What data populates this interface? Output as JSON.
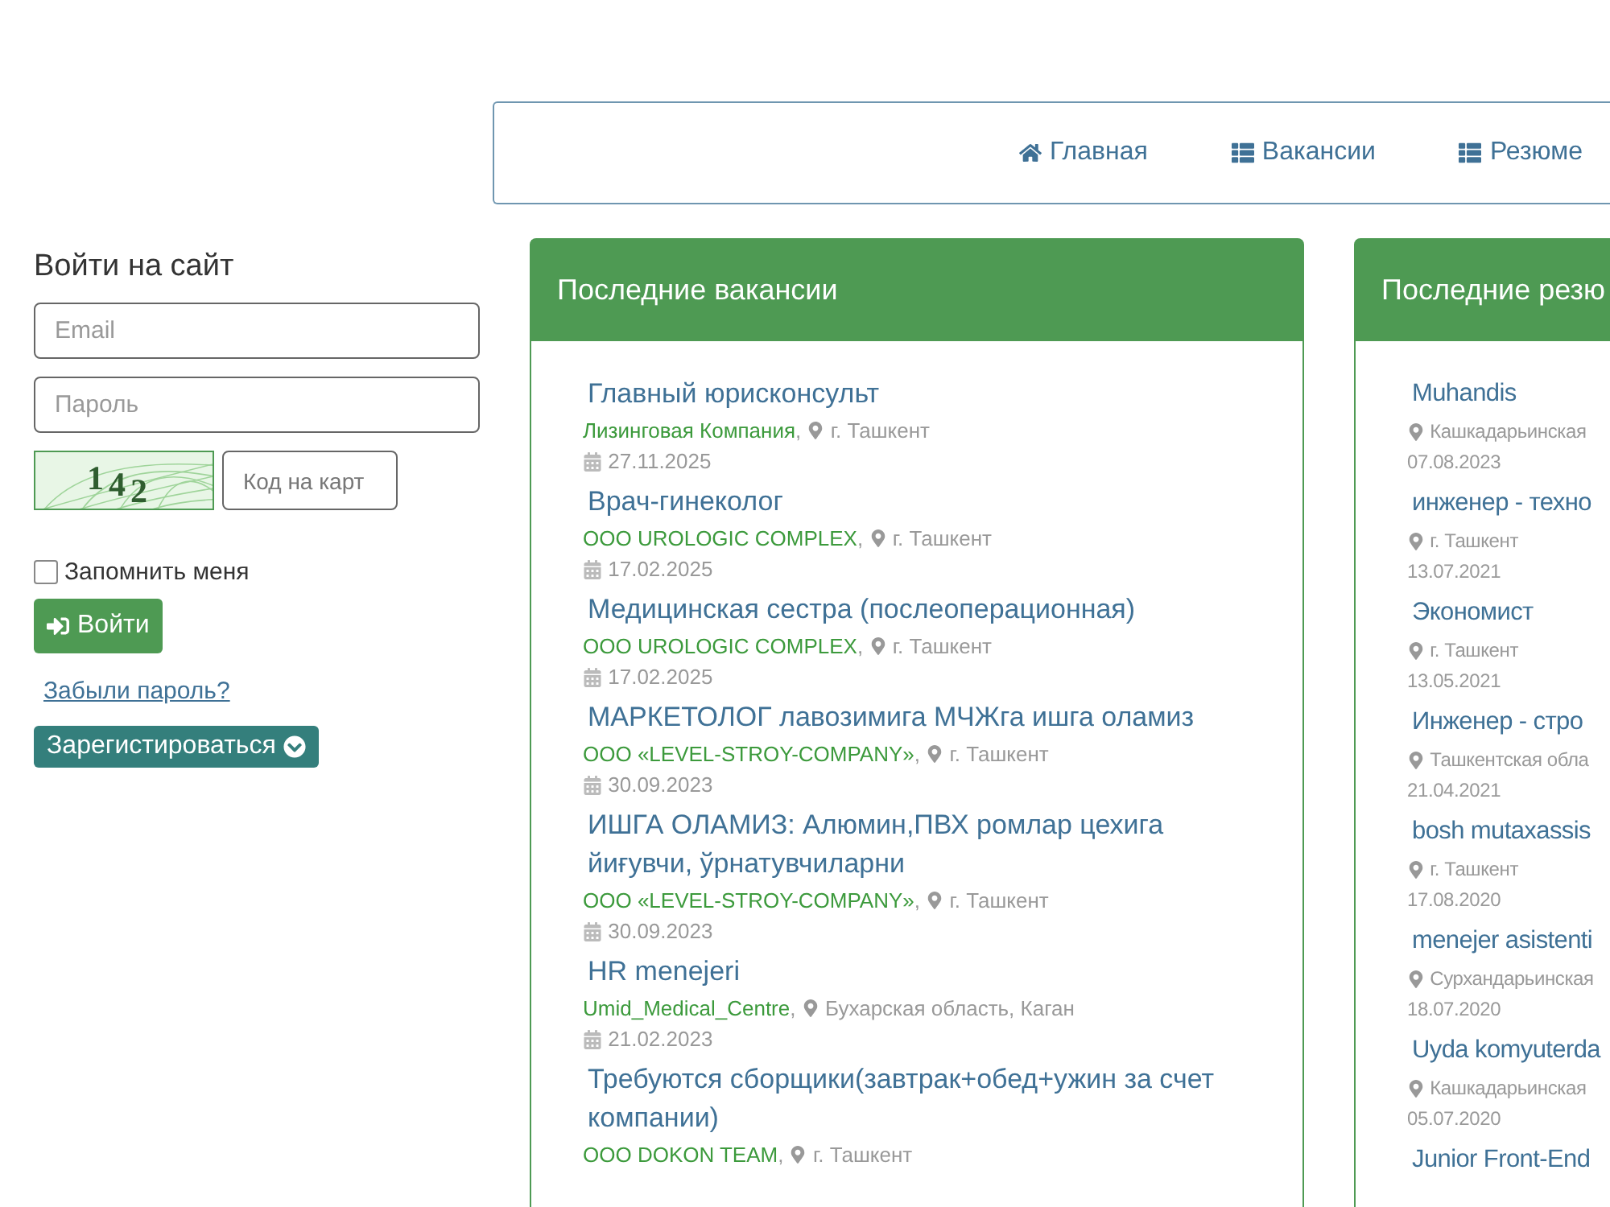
{
  "nav": {
    "items": [
      {
        "label": "Главная"
      },
      {
        "label": "Вакансии"
      },
      {
        "label": "Резюме"
      }
    ]
  },
  "login": {
    "title": "Войти на сайт",
    "email": {
      "placeholder": "Email"
    },
    "password": {
      "placeholder": "Пароль"
    },
    "captcha": {
      "code": "142",
      "placeholder": "Код на карт"
    },
    "remember": {
      "label": "Запомнить меня",
      "checked": false
    },
    "submit": "Войти",
    "forgot": "Забыли пароль?",
    "register": "Зарегистироваться"
  },
  "vacancies": {
    "title": "Последние вакансии",
    "items": [
      {
        "title": "Главный юрисконсульт",
        "company": "Лизинговая Компания",
        "separator": ",",
        "location": "г. Ташкент",
        "date": "27.11.2025"
      },
      {
        "title": "Врач-гинеколог",
        "company": "ООО UROLOGIC COMPLEX",
        "separator": ",",
        "location": "г. Ташкент",
        "date": "17.02.2025"
      },
      {
        "title": "Медицинская сестра (послеоперационная)",
        "company": "ООО UROLOGIC COMPLEX",
        "separator": ",",
        "location": "г. Ташкент",
        "date": "17.02.2025"
      },
      {
        "title": "МАРКЕТОЛОГ лавозимига МЧЖга ишга оламиз",
        "company": "ООО «LEVEL-STROY-COMPANY»",
        "separator": ",",
        "location": "г. Ташкент",
        "date": "30.09.2023"
      },
      {
        "title": "ИШГА ОЛАМИЗ: Алюмин,ПВХ ромлар цехига йиғувчи, ўрнатувчиларни",
        "company": "ООО «LEVEL-STROY-COMPANY»",
        "separator": ",",
        "location": "г. Ташкент",
        "date": "30.09.2023"
      },
      {
        "title": "HR menejeri",
        "company": "Umid_Medical_Centre",
        "separator": ",",
        "location": "Бухарская область, Каган",
        "date": "21.02.2023"
      },
      {
        "title": "Требуются сборщики(завтрак+обед+ужин за счет компании)",
        "company": "ООО DOKON TEAM",
        "separator": ",",
        "location": "г. Ташкент"
      }
    ]
  },
  "resumes": {
    "title": "Последние резю",
    "items": [
      {
        "title": "Muhandis",
        "location": "Кашкадарьинская",
        "date": "07.08.2023"
      },
      {
        "title": "инженер - техно",
        "location": "г. Ташкент",
        "date": "13.07.2021"
      },
      {
        "title": "Экономист",
        "location": "г. Ташкент",
        "date": "13.05.2021"
      },
      {
        "title": "Инженер - стро",
        "location": "Ташкентская обла",
        "date": "21.04.2021"
      },
      {
        "title": "bosh mutaxassis",
        "location": "г. Ташкент",
        "date": "17.08.2020"
      },
      {
        "title": "menejer asistenti",
        "location": "Сурхандарьинская",
        "date": "18.07.2020"
      },
      {
        "title": "Uyda komyuterda",
        "location": "Кашкадарьинская",
        "date": "05.07.2020"
      },
      {
        "title": "Junior Front-End"
      }
    ]
  }
}
